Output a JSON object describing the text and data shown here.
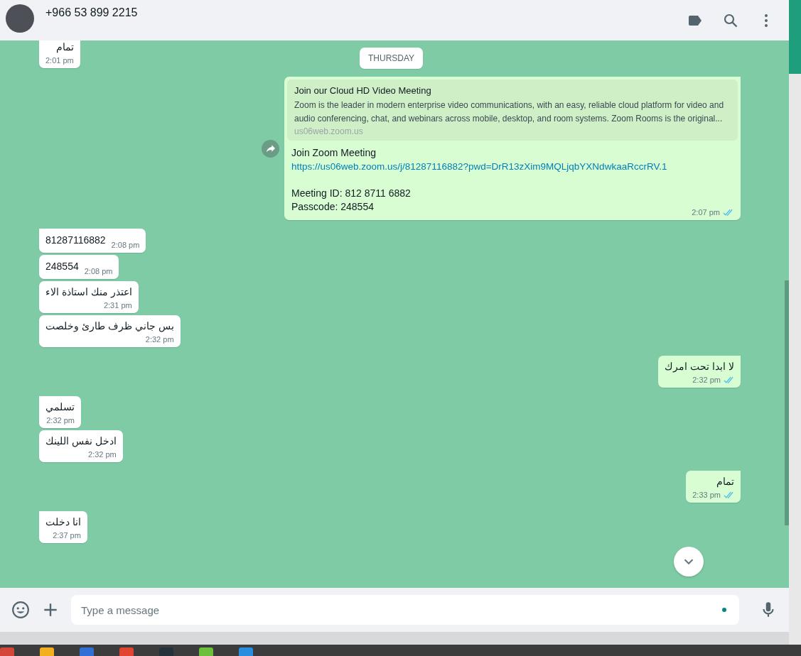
{
  "header": {
    "contact": "+966 53 899 2215"
  },
  "day_label": "THURSDAY",
  "messages": [
    {
      "kind": "text",
      "outgoing": false,
      "tail": false,
      "inline_time": false,
      "text": "تمام",
      "time": "2:01 pm"
    },
    {
      "kind": "link",
      "outgoing": true,
      "tail": true,
      "forward": true,
      "read": true,
      "time": "2:07 pm",
      "preview": {
        "title": "Join our Cloud HD Video Meeting",
        "description": "Zoom is the leader in modern enterprise video communications, with an easy, reliable cloud platform for video and audio conferencing, chat, and webinars across mobile, desktop, and room systems. Zoom Rooms is the original...",
        "domain": "us06web.zoom.us"
      },
      "paragraphs": [
        [
          {
            "kind": "text",
            "text": "Join Zoom Meeting"
          },
          {
            "kind": "link",
            "text": "https://us06web.zoom.us/j/81287116882?pwd=DrR13zXim9MQLjqbYXNdwkaaRccrRV.1"
          }
        ],
        [
          {
            "kind": "text",
            "text": "Meeting ID: 812 8711 6882"
          },
          {
            "kind": "text",
            "text": "Passcode: 248554"
          }
        ]
      ]
    },
    {
      "kind": "text",
      "outgoing": false,
      "tail": true,
      "inline_time": true,
      "text": "81287116882",
      "time": "2:08 pm"
    },
    {
      "kind": "text",
      "outgoing": false,
      "tail": false,
      "inline_time": true,
      "text": "248554",
      "time": "2:08 pm"
    },
    {
      "kind": "text",
      "outgoing": false,
      "tail": false,
      "inline_time": false,
      "text": "اعتذر منك استاذة الاء",
      "time": "2:31 pm"
    },
    {
      "kind": "text",
      "outgoing": false,
      "tail": false,
      "inline_time": false,
      "text": "بس جاني ظرف طارئ وخلصت",
      "time": "2:32 pm"
    },
    {
      "kind": "text",
      "outgoing": true,
      "tail": true,
      "inline_time": false,
      "read": true,
      "text": "لا ابدا تحت امرك",
      "time": "2:32 pm"
    },
    {
      "kind": "text",
      "outgoing": false,
      "tail": true,
      "inline_time": false,
      "text": "تسلمي",
      "time": "2:32 pm"
    },
    {
      "kind": "text",
      "outgoing": false,
      "tail": false,
      "inline_time": false,
      "text": "ادخل نفس اللينك",
      "time": "2:32 pm"
    },
    {
      "kind": "text",
      "outgoing": true,
      "tail": true,
      "inline_time": false,
      "read": true,
      "text": "تمام",
      "time": "2:33 pm"
    },
    {
      "kind": "text",
      "outgoing": false,
      "tail": true,
      "inline_time": false,
      "text": "انا دخلت",
      "time": "2:37 pm"
    }
  ],
  "composer": {
    "placeholder": "Type a message"
  }
}
